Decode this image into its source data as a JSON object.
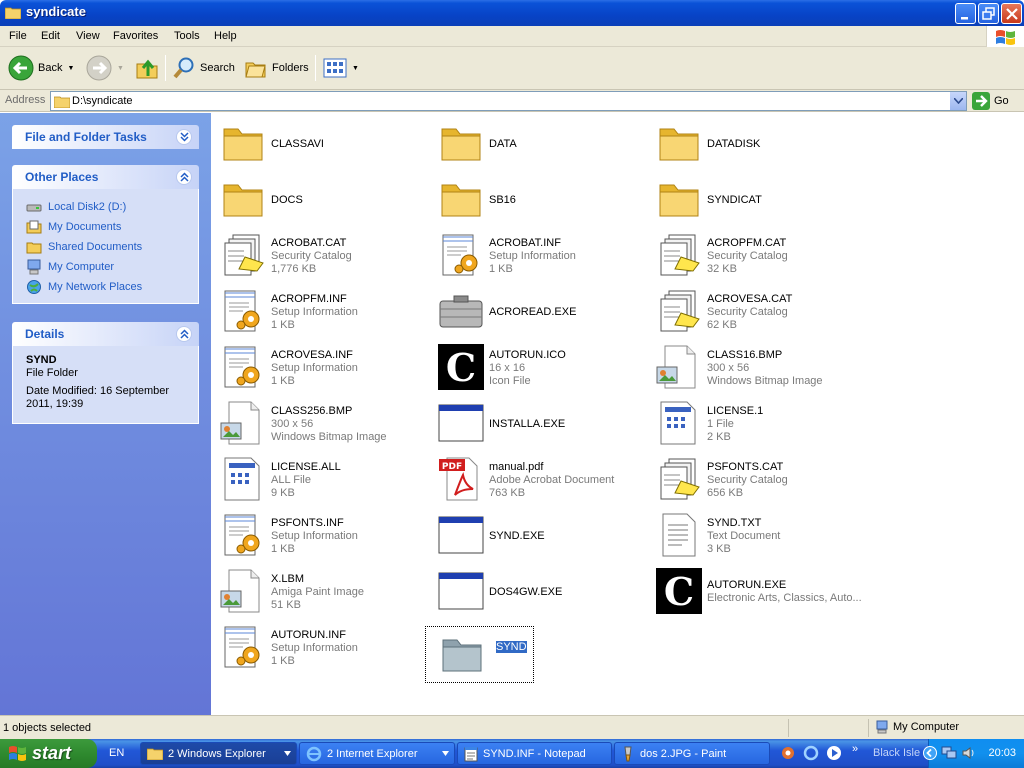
{
  "window": {
    "title": "syndicate"
  },
  "menu": [
    "File",
    "Edit",
    "View",
    "Favorites",
    "Tools",
    "Help"
  ],
  "toolbar": {
    "back": "Back",
    "search": "Search",
    "folders": "Folders"
  },
  "address": {
    "label": "Address",
    "path": "D:\\syndicate",
    "go": "Go"
  },
  "tasks": {
    "file_folder_title": "File and Folder Tasks",
    "other_places_title": "Other Places",
    "other_places": [
      "Local Disk2 (D:)",
      "My Documents",
      "Shared Documents",
      "My Computer",
      "My Network Places"
    ],
    "details_title": "Details",
    "details": {
      "name": "SYND",
      "type": "File Folder",
      "modified": "Date Modified: 16 September 2011, 19:39"
    }
  },
  "files": [
    {
      "name": "CLASSAVI",
      "line1": "",
      "line2": "",
      "icon": "folder"
    },
    {
      "name": "DATA",
      "line1": "",
      "line2": "",
      "icon": "folder"
    },
    {
      "name": "DATADISK",
      "line1": "",
      "line2": "",
      "icon": "folder"
    },
    {
      "name": "DOCS",
      "line1": "",
      "line2": "",
      "icon": "folder"
    },
    {
      "name": "SB16",
      "line1": "",
      "line2": "",
      "icon": "folder"
    },
    {
      "name": "SYNDICAT",
      "line1": "",
      "line2": "",
      "icon": "folder"
    },
    {
      "name": "ACROBAT.CAT",
      "line1": "Security Catalog",
      "line2": "1,776 KB",
      "icon": "catalog"
    },
    {
      "name": "ACROBAT.INF",
      "line1": "Setup Information",
      "line2": "1 KB",
      "icon": "inf"
    },
    {
      "name": "ACROPFM.CAT",
      "line1": "Security Catalog",
      "line2": "32 KB",
      "icon": "catalog"
    },
    {
      "name": "ACROPFM.INF",
      "line1": "Setup Information",
      "line2": "1 KB",
      "icon": "inf"
    },
    {
      "name": "ACROREAD.EXE",
      "line1": "",
      "line2": "",
      "icon": "exe-gray"
    },
    {
      "name": "ACROVESA.CAT",
      "line1": "Security Catalog",
      "line2": "62 KB",
      "icon": "catalog"
    },
    {
      "name": "ACROVESA.INF",
      "line1": "Setup Information",
      "line2": "1 KB",
      "icon": "inf"
    },
    {
      "name": "AUTORUN.ICO",
      "line1": "16 x 16",
      "line2": "Icon File",
      "icon": "c-logo"
    },
    {
      "name": "CLASS16.BMP",
      "line1": "300 x 56",
      "line2": "Windows Bitmap Image",
      "icon": "image"
    },
    {
      "name": "CLASS256.BMP",
      "line1": "300 x 56",
      "line2": "Windows Bitmap Image",
      "icon": "image"
    },
    {
      "name": "INSTALLA.EXE",
      "line1": "",
      "line2": "",
      "icon": "window"
    },
    {
      "name": "LICENSE.1",
      "line1": "1 File",
      "line2": "2 KB",
      "icon": "generic"
    },
    {
      "name": "LICENSE.ALL",
      "line1": "ALL File",
      "line2": "9 KB",
      "icon": "generic"
    },
    {
      "name": "manual.pdf",
      "line1": "Adobe Acrobat Document",
      "line2": "763 KB",
      "icon": "pdf"
    },
    {
      "name": "PSFONTS.CAT",
      "line1": "Security Catalog",
      "line2": "656 KB",
      "icon": "catalog"
    },
    {
      "name": "PSFONTS.INF",
      "line1": "Setup Information",
      "line2": "1 KB",
      "icon": "inf"
    },
    {
      "name": "SYND.EXE",
      "line1": "",
      "line2": "",
      "icon": "window"
    },
    {
      "name": "SYND.TXT",
      "line1": "Text Document",
      "line2": "3 KB",
      "icon": "text"
    },
    {
      "name": "X.LBM",
      "line1": "Amiga Paint Image",
      "line2": "51 KB",
      "icon": "image"
    },
    {
      "name": "DOS4GW.EXE",
      "line1": "",
      "line2": "",
      "icon": "window"
    },
    {
      "name": "AUTORUN.EXE",
      "line1": "Electronic Arts, Classics, Auto...",
      "line2": "",
      "icon": "c-logo"
    },
    {
      "name": "AUTORUN.INF",
      "line1": "Setup Information",
      "line2": "1 KB",
      "icon": "inf"
    },
    {
      "name": "SYND",
      "line1": "",
      "line2": "",
      "icon": "folder-gray",
      "selected": true
    }
  ],
  "status": {
    "selected": "1 objects selected",
    "location": "My Computer"
  },
  "taskbar": {
    "start": "start",
    "lang": "EN",
    "buttons": [
      "2 Windows Explorer",
      "2 Internet Explorer",
      "SYND.INF - Notepad",
      "dos 2.JPG - Paint"
    ],
    "tray_label": "Black Isle",
    "clock": "20:03"
  },
  "colors": {
    "titlebar": "#0a52d8",
    "taskpane": "#6375d6",
    "link": "#215dc6",
    "selection": "#316ac5",
    "start": "#2f8a2f"
  }
}
